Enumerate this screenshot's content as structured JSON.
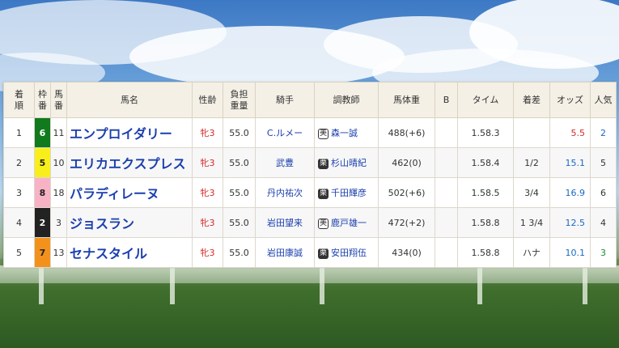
{
  "header": {
    "finish": "着順",
    "frame": "枠番",
    "number": "馬番",
    "horse": "馬名",
    "sexage": "性齢",
    "weight": "負担重量",
    "jockey": "騎手",
    "trainer": "調教師",
    "body_weight": "馬体重",
    "blinker": "B",
    "time": "タイム",
    "margin": "着差",
    "odds": "オッズ",
    "popularity": "人気"
  },
  "rows": [
    {
      "finish": "1",
      "frame": "6",
      "number": "11",
      "horse": "エンプロイダリー",
      "sexage": "牝3",
      "weight": "55.0",
      "jockey": "C.ルメー",
      "affiliation": "美",
      "trainer": "森一誠",
      "body_weight": "488(+6)",
      "blinker": "",
      "time": "1.58.3",
      "margin": "",
      "odds": "5.5",
      "popularity": "2"
    },
    {
      "finish": "2",
      "frame": "5",
      "number": "10",
      "horse": "エリカエクスプレス",
      "sexage": "牝3",
      "weight": "55.0",
      "jockey": "武豊",
      "affiliation": "栗",
      "trainer": "杉山晴紀",
      "body_weight": "462(0)",
      "blinker": "",
      "time": "1.58.4",
      "margin": "1/2",
      "odds": "15.1",
      "popularity": "5"
    },
    {
      "finish": "3",
      "frame": "8",
      "number": "18",
      "horse": "パラディレーヌ",
      "sexage": "牝3",
      "weight": "55.0",
      "jockey": "丹内祐次",
      "affiliation": "栗",
      "trainer": "千田輝彦",
      "body_weight": "502(+6)",
      "blinker": "",
      "time": "1.58.5",
      "margin": "3/4",
      "odds": "16.9",
      "popularity": "6"
    },
    {
      "finish": "4",
      "frame": "2",
      "number": "3",
      "horse": "ジョスラン",
      "sexage": "牝3",
      "weight": "55.0",
      "jockey": "岩田望来",
      "affiliation": "美",
      "trainer": "鹿戸雄一",
      "body_weight": "472(+2)",
      "blinker": "",
      "time": "1.58.8",
      "margin": "1 3/4",
      "odds": "12.5",
      "popularity": "4"
    },
    {
      "finish": "5",
      "frame": "7",
      "number": "13",
      "horse": "セナスタイル",
      "sexage": "牝3",
      "weight": "55.0",
      "jockey": "岩田康誠",
      "affiliation": "栗",
      "trainer": "安田翔伍",
      "body_weight": "434(0)",
      "blinker": "",
      "time": "1.58.8",
      "margin": "ハナ",
      "odds": "10.1",
      "popularity": "3"
    }
  ],
  "colors": {
    "frame_6": "#117a1c",
    "frame_5": "#f8ee1b",
    "frame_8": "#f7b3c5",
    "frame_2": "#222222",
    "frame_7": "#f2921d",
    "horse_name": "#1b3fae",
    "sex": "#d42a2a",
    "odds_favourite": "#d42a2a",
    "odds": "#1b67c4",
    "header_bg": "#f4f0e6"
  }
}
